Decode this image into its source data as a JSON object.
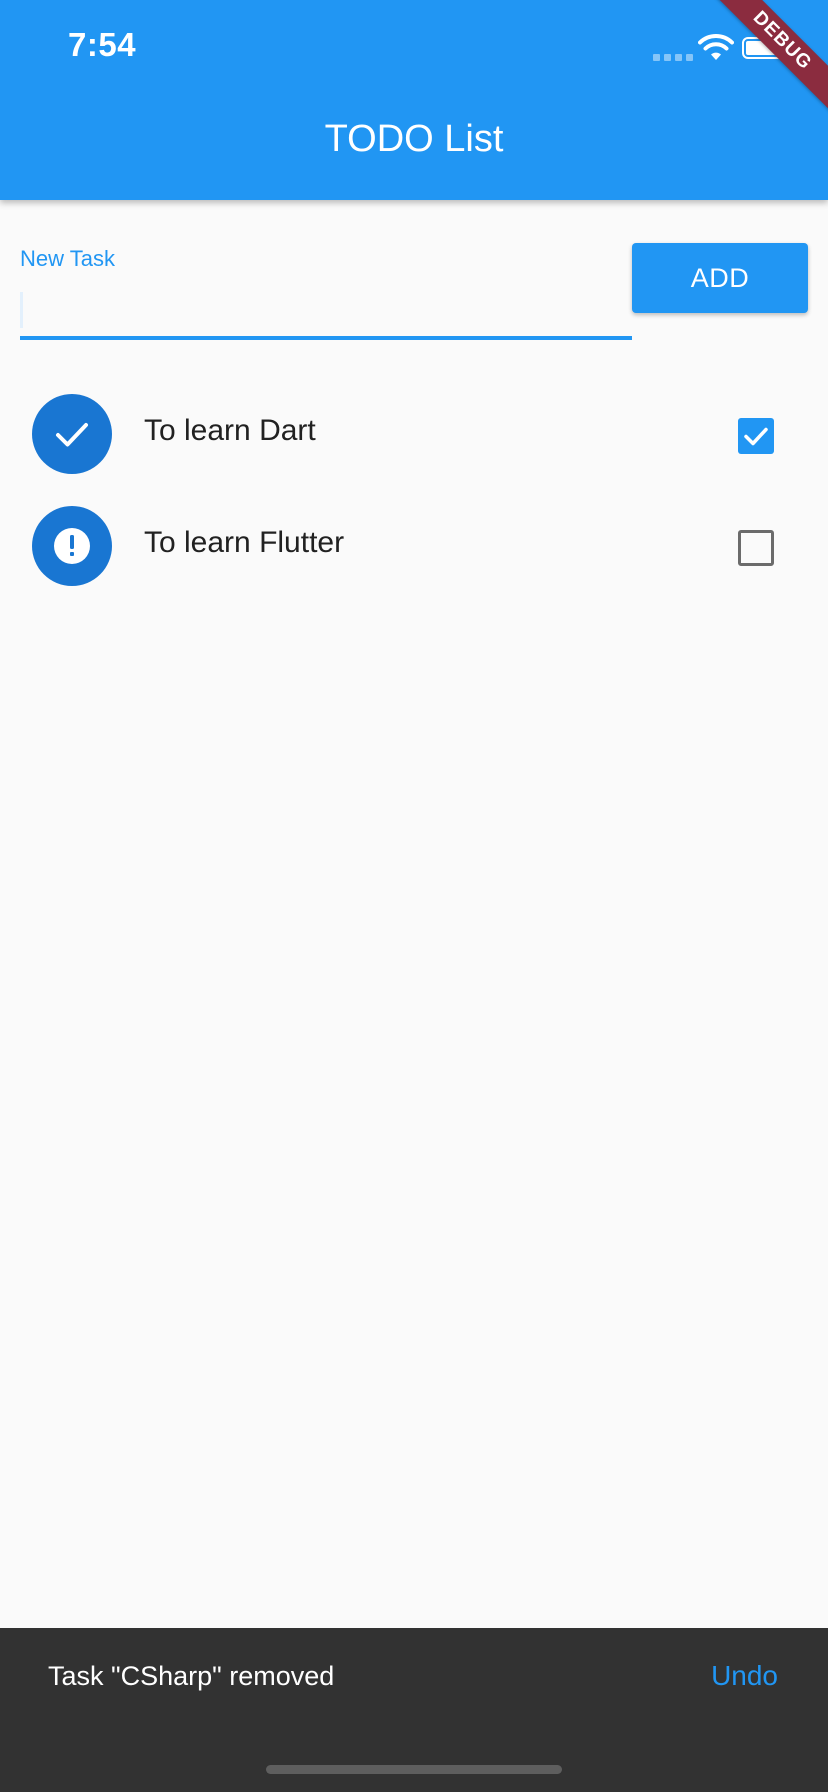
{
  "status_bar": {
    "time": "7:54",
    "signal_icon": "signal-icon",
    "wifi_icon": "wifi-icon",
    "battery_icon": "battery-icon"
  },
  "debug_banner": "DEBUG",
  "app_bar": {
    "title": "TODO List",
    "color": "#2196f3"
  },
  "new_task": {
    "label": "New Task",
    "value": "",
    "add_label": "ADD"
  },
  "tasks": [
    {
      "title": "To learn Dart",
      "done": true,
      "icon": "check-icon"
    },
    {
      "title": "To learn Flutter",
      "done": false,
      "icon": "exclamation-icon"
    }
  ],
  "snackbar": {
    "message": "Task \"CSharp\" removed",
    "action": "Undo"
  },
  "colors": {
    "primary": "#2196f3",
    "avatar": "#1976d2",
    "snackbar": "#323232",
    "debug": "#8b2c3f"
  }
}
